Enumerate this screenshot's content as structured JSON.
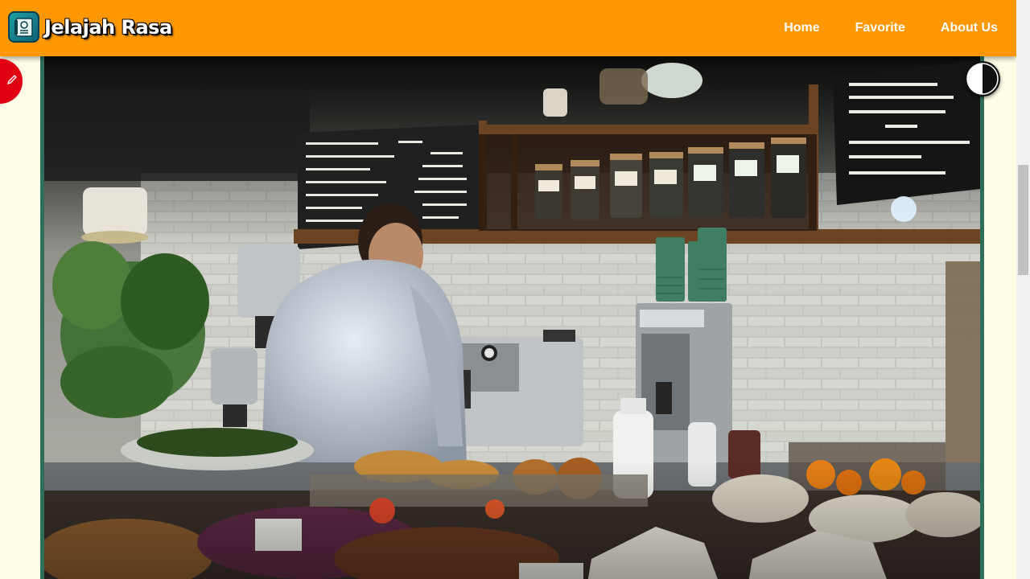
{
  "brand": {
    "title": "Jelajah Rasa",
    "logo_icon": "menu-book-icon"
  },
  "nav": {
    "items": [
      {
        "label": "Home"
      },
      {
        "label": "Favorite"
      },
      {
        "label": "About Us"
      }
    ]
  },
  "hero": {
    "alt": "Café counter with a barista working behind food display"
  },
  "floating": {
    "left_button_icon": "pencil-icon",
    "theme_toggle_icon": "contrast-icon"
  },
  "colors": {
    "navbar": "#ff9800",
    "background": "#fffde6",
    "frame": "#2f6f5a",
    "accent_red": "#e00012"
  }
}
